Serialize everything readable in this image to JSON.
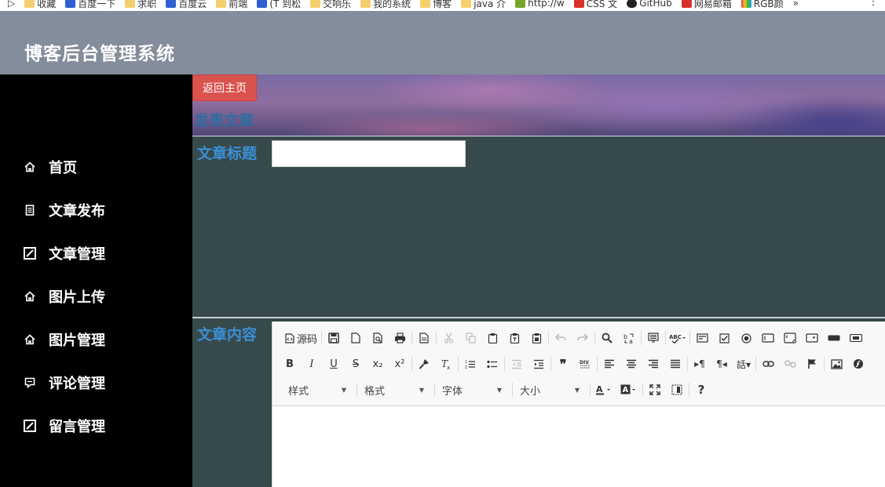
{
  "bookmarks": [
    {
      "label": "收藏",
      "icon": "favorites-icon"
    },
    {
      "label": "百度一下",
      "icon": "baidu-icon"
    },
    {
      "label": "求职",
      "icon": "folder-icon"
    },
    {
      "label": "百度云",
      "icon": "baidu-cloud-icon"
    },
    {
      "label": "前端",
      "icon": "folder-icon"
    },
    {
      "label": "(T 到松",
      "icon": "site-icon"
    },
    {
      "label": "交响乐",
      "icon": "folder-icon"
    },
    {
      "label": "我的系统",
      "icon": "folder-icon"
    },
    {
      "label": "博客",
      "icon": "folder-icon"
    },
    {
      "label": "java 介",
      "icon": "folder-icon"
    },
    {
      "label": "http://w",
      "icon": "site-icon"
    },
    {
      "label": "CSS 文",
      "icon": "site-icon"
    },
    {
      "label": "GitHub",
      "icon": "github-icon"
    },
    {
      "label": "网易邮箱",
      "icon": "mail-icon"
    },
    {
      "label": "RGB颜",
      "icon": "rgb-icon"
    }
  ],
  "header": {
    "title": "博客后台管理系统"
  },
  "sidebar": {
    "items": [
      {
        "label": "首页",
        "icon": "home-icon"
      },
      {
        "label": "文章发布",
        "icon": "document-icon"
      },
      {
        "label": "文章管理",
        "icon": "edit-icon"
      },
      {
        "label": "图片上传",
        "icon": "home-icon"
      },
      {
        "label": "图片管理",
        "icon": "home-icon"
      },
      {
        "label": "评论管理",
        "icon": "comment-icon"
      },
      {
        "label": "留言管理",
        "icon": "edit-icon"
      }
    ]
  },
  "main": {
    "back_button": "返回主页",
    "heading": "发表文章",
    "title_label": "文章标题",
    "title_value": "",
    "content_label": "文章内容"
  },
  "editor": {
    "source_label": "源码",
    "combos": {
      "style": "样式",
      "format": "格式",
      "font": "字体",
      "size": "大小"
    },
    "row2_glyphs": {
      "bold": "B",
      "italic": "I",
      "underline": "U",
      "strike": "S",
      "subscript": "x₂",
      "superscript": "x²"
    },
    "help": "?"
  },
  "colors": {
    "header_bg": "#838d9b",
    "sidebar_bg": "#000000",
    "content_bg": "#374a4b",
    "label_blue": "#3a8fd6",
    "danger_button": "#d9534f"
  }
}
